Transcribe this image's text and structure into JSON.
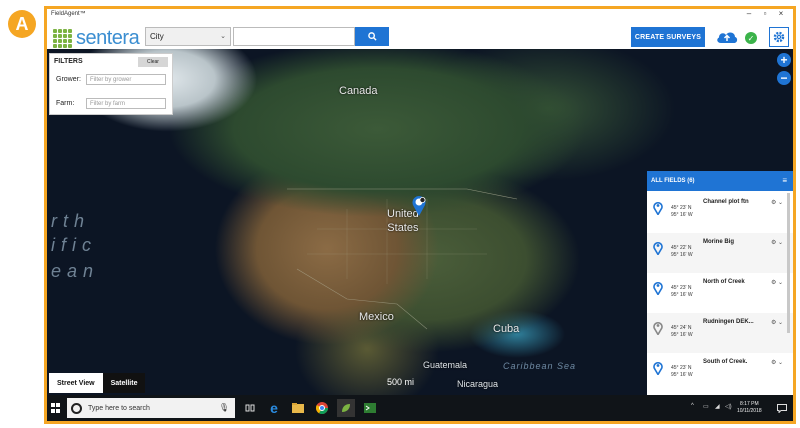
{
  "badge": {
    "letter": "A"
  },
  "window": {
    "title": "FieldAgent™",
    "controls": {
      "minimize": "–",
      "maximize": "▫",
      "close": "×"
    }
  },
  "header": {
    "logo_text": "sentera",
    "location_select": {
      "value": "City"
    },
    "search": {
      "placeholder": ""
    },
    "create_button": "CREATE SURVEYS"
  },
  "filters": {
    "title": "FILTERS",
    "clear": "Clear",
    "grower_label": "Grower:",
    "grower_placeholder": "Filter by grower",
    "farm_label": "Farm:",
    "farm_placeholder": "Filter by farm"
  },
  "map": {
    "labels": {
      "canada": "Canada",
      "united_states": "United\nStates",
      "mexico": "Mexico",
      "cuba": "Cuba",
      "guatemala": "Guatemala",
      "nicaragua": "Nicaragua",
      "caribbean": "Caribbean Sea"
    },
    "ocean_fragments": [
      "rth",
      "ific",
      "ean"
    ],
    "map_types": {
      "street": "Street View",
      "satellite": "Satellite"
    },
    "scale_text": "500 mi"
  },
  "fields_panel": {
    "title": "ALL FIELDS (6)",
    "rows": [
      {
        "name": "Channel plot ftn",
        "lat": "45° 23' N",
        "lon": "95° 16' W",
        "pin_color": "#1f74d4"
      },
      {
        "name": "Morine Big",
        "lat": "45° 22' N",
        "lon": "95° 16' W",
        "pin_color": "#1f74d4"
      },
      {
        "name": "North of Creek",
        "lat": "45° 23' N",
        "lon": "95° 16' W",
        "pin_color": "#1f74d4"
      },
      {
        "name": "Rudningen DEK...",
        "lat": "45° 24' N",
        "lon": "95° 16' W",
        "pin_color": "#888888"
      },
      {
        "name": "South of Creek.",
        "lat": "45° 23' N",
        "lon": "95° 16' W",
        "pin_color": "#1f74d4"
      }
    ]
  },
  "taskbar": {
    "search_placeholder": "Type here to search",
    "time": "8:17 PM",
    "date": "10/11/2018"
  },
  "colors": {
    "accent_blue": "#1f74d4",
    "frame_orange": "#f5a623",
    "status_green": "#3bb34a"
  }
}
